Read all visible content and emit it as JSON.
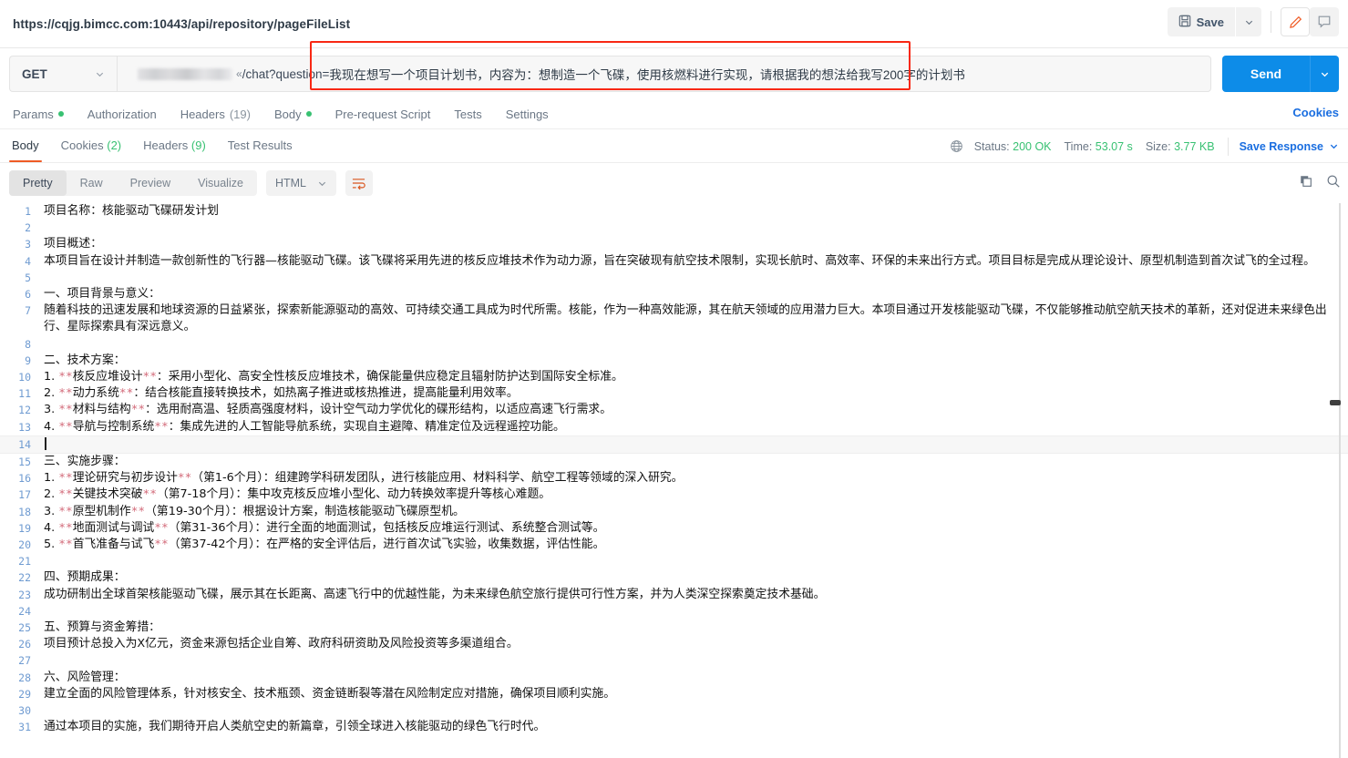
{
  "topbar": {
    "request_url": "https://cqjg.bimcc.com:10443/api/repository/pageFileList",
    "save_label": "Save",
    "save_icon": "floppy-disk-icon",
    "caret_icon": "chevron-down-icon",
    "edit_icon": "pencil-icon",
    "comment_icon": "comment-icon"
  },
  "request": {
    "method": "GET",
    "method_caret": "chevron-down-icon",
    "url_path": "/chat?question=",
    "url_mid": "«",
    "query_value": "我现在想写一个项目计划书，内容为：想制造一个飞碟，使用核燃料进行实现，请根据我的想法给我写200字的计划书",
    "send_label": "Send",
    "send_caret": "chevron-down-icon"
  },
  "request_tabs": [
    {
      "label": "Params",
      "dot": true
    },
    {
      "label": "Authorization",
      "dot": false
    },
    {
      "label": "Headers",
      "count": "(19)"
    },
    {
      "label": "Body",
      "dot": true
    },
    {
      "label": "Pre-request Script"
    },
    {
      "label": "Tests"
    },
    {
      "label": "Settings"
    }
  ],
  "cookies_link": "Cookies",
  "response_tabs": [
    {
      "label": "Body",
      "active": true
    },
    {
      "label": "Cookies",
      "count": "(2)"
    },
    {
      "label": "Headers",
      "count": "(9)"
    },
    {
      "label": "Test Results"
    }
  ],
  "response_meta": {
    "globe_icon": "globe-icon",
    "status_label": "Status:",
    "status_value": "200 OK",
    "time_label": "Time:",
    "time_value": "53.07 s",
    "size_label": "Size:",
    "size_value": "3.77 KB",
    "save_response": "Save Response",
    "save_response_caret": "chevron-down-icon"
  },
  "body_toolbar": {
    "segments": [
      {
        "label": "Pretty",
        "active": true
      },
      {
        "label": "Raw",
        "active": false
      },
      {
        "label": "Preview",
        "active": false
      },
      {
        "label": "Visualize",
        "active": false
      }
    ],
    "format": "HTML",
    "format_caret": "chevron-down-icon",
    "wrap_icon": "word-wrap-icon",
    "copy_icon": "copy-icon",
    "search_icon": "search-icon"
  },
  "colors": {
    "accent_orange": "#ef5b25",
    "send_blue": "#0d8ce8",
    "link_blue": "#1a6ee0",
    "status_green": "#38c172",
    "annotation_red": "#f82814",
    "line_number": "#6f9bd1"
  },
  "code_lines": [
    {
      "n": 1,
      "text": "项目名称：核能驱动飞碟研发计划"
    },
    {
      "n": 2,
      "text": ""
    },
    {
      "n": 3,
      "text": "项目概述："
    },
    {
      "n": 4,
      "text": "本项目旨在设计并制造一款创新性的飞行器—核能驱动飞碟。该飞碟将采用先进的核反应堆技术作为动力源，旨在突破现有航空技术限制，实现长航时、高效率、环保的未来出行方式。项目目标是完成从理论设计、原型机制造到首次试飞的全过程。"
    },
    {
      "n": 5,
      "text": ""
    },
    {
      "n": 6,
      "text": "一、项目背景与意义："
    },
    {
      "n": 7,
      "text": "随着科技的迅速发展和地球资源的日益紧张，探索新能源驱动的高效、可持续交通工具成为时代所需。核能，作为一种高效能源，其在航天领域的应用潜力巨大。本项目通过开发核能驱动飞碟，不仅能够推动航空航天技术的革新，还对促进未来绿色出行、星际探索具有深远意义。"
    },
    {
      "n": 8,
      "text": ""
    },
    {
      "n": 9,
      "text": "二、技术方案："
    },
    {
      "n": 10,
      "text": "1. **核反应堆设计**：采用小型化、高安全性核反应堆技术，确保能量供应稳定且辐射防护达到国际安全标准。"
    },
    {
      "n": 11,
      "text": "2. **动力系统**：结合核能直接转换技术，如热离子推进或核热推进，提高能量利用效率。"
    },
    {
      "n": 12,
      "text": "3. **材料与结构**：选用耐高温、轻质高强度材料，设计空气动力学优化的碟形结构，以适应高速飞行需求。"
    },
    {
      "n": 13,
      "text": "4. **导航与控制系统**：集成先进的人工智能导航系统，实现自主避障、精准定位及远程遥控功能。"
    },
    {
      "n": 14,
      "text": "",
      "caret": true,
      "highlight": true
    },
    {
      "n": 15,
      "text": "三、实施步骤："
    },
    {
      "n": 16,
      "text": "1. **理论研究与初步设计**（第1-6个月）：组建跨学科研发团队，进行核能应用、材料科学、航空工程等领域的深入研究。"
    },
    {
      "n": 17,
      "text": "2. **关键技术突破**（第7-18个月）：集中攻克核反应堆小型化、动力转换效率提升等核心难题。"
    },
    {
      "n": 18,
      "text": "3. **原型机制作**（第19-30个月）：根据设计方案，制造核能驱动飞碟原型机。"
    },
    {
      "n": 19,
      "text": "4. **地面测试与调试**（第31-36个月）：进行全面的地面测试，包括核反应堆运行测试、系统整合测试等。"
    },
    {
      "n": 20,
      "text": "5. **首飞准备与试飞**（第37-42个月）：在严格的安全评估后，进行首次试飞实验，收集数据，评估性能。"
    },
    {
      "n": 21,
      "text": ""
    },
    {
      "n": 22,
      "text": "四、预期成果："
    },
    {
      "n": 23,
      "text": "成功研制出全球首架核能驱动飞碟，展示其在长距离、高速飞行中的优越性能，为未来绿色航空旅行提供可行性方案，并为人类深空探索奠定技术基础。"
    },
    {
      "n": 24,
      "text": ""
    },
    {
      "n": 25,
      "text": "五、预算与资金筹措："
    },
    {
      "n": 26,
      "text": "项目预计总投入为X亿元，资金来源包括企业自筹、政府科研资助及风险投资等多渠道组合。"
    },
    {
      "n": 27,
      "text": ""
    },
    {
      "n": 28,
      "text": "六、风险管理："
    },
    {
      "n": 29,
      "text": "建立全面的风险管理体系，针对核安全、技术瓶颈、资金链断裂等潜在风险制定应对措施，确保项目顺利实施。"
    },
    {
      "n": 30,
      "text": ""
    },
    {
      "n": 31,
      "text": "通过本项目的实施，我们期待开启人类航空史的新篇章，引领全球进入核能驱动的绿色飞行时代。"
    }
  ]
}
